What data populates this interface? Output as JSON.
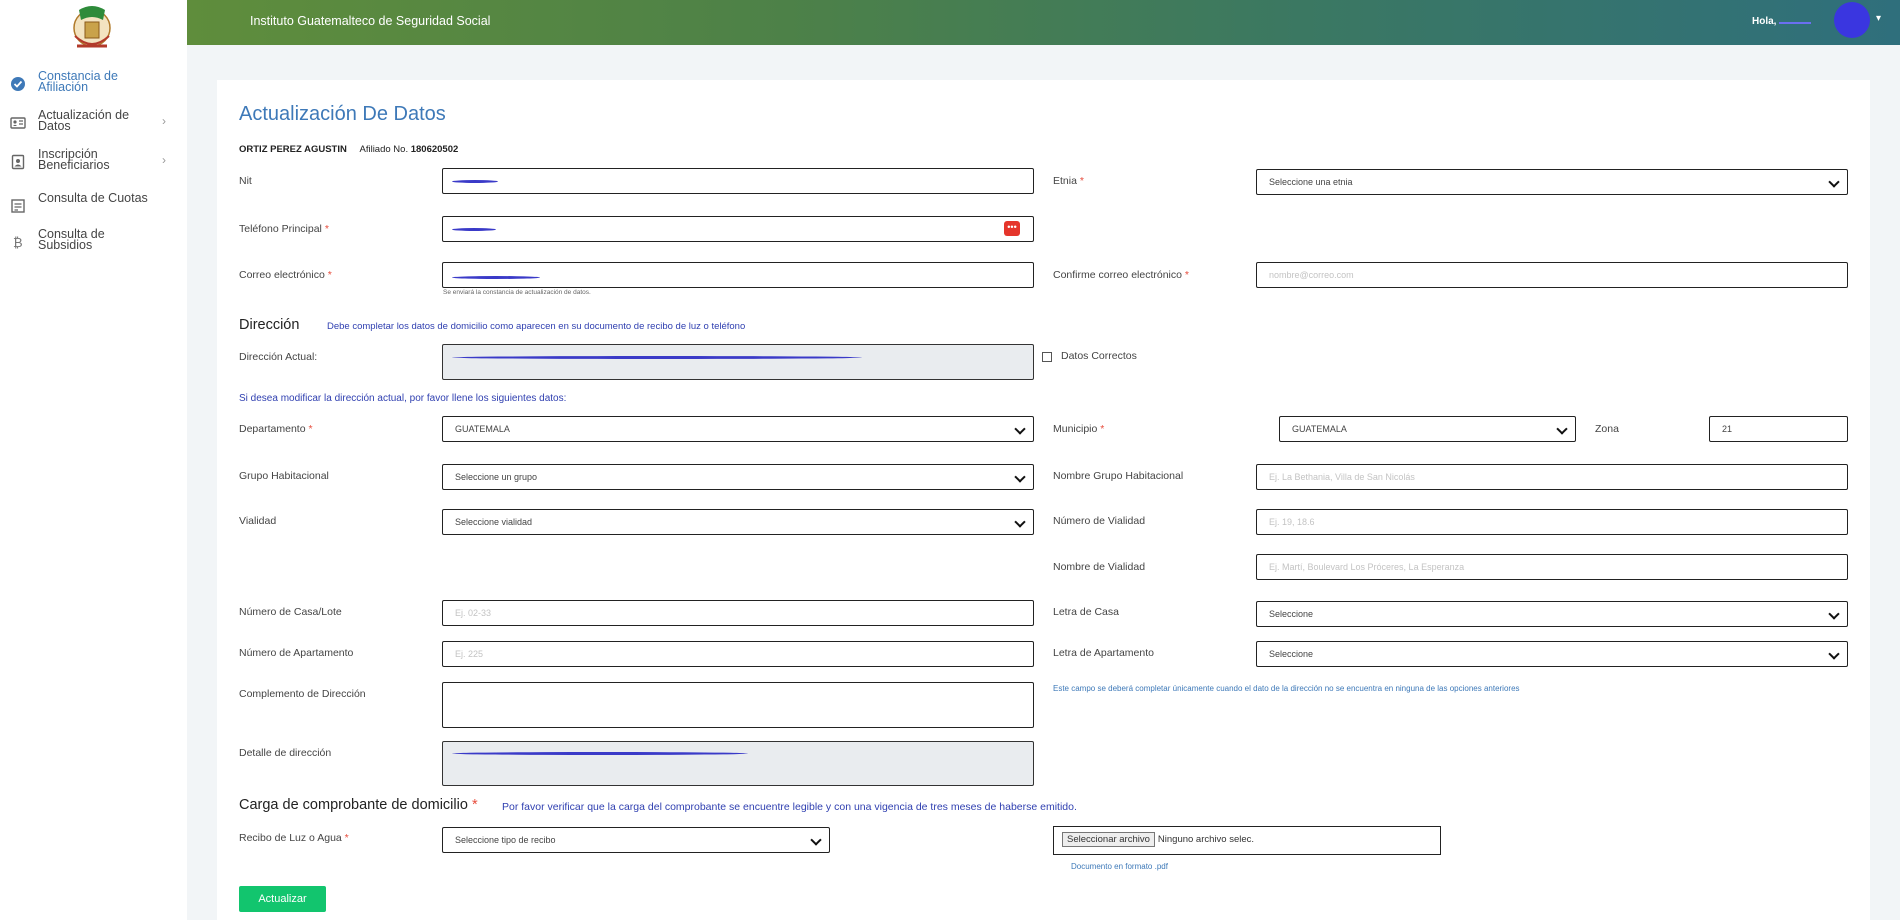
{
  "topbar": {
    "title": "Instituto Guatemalteco de Seguridad Social",
    "hello": "Hola, "
  },
  "sidebar": {
    "items": [
      {
        "label": "Constancia de Afiliación",
        "icon": "check-circle-icon",
        "active": true
      },
      {
        "label": "Actualización de Datos",
        "icon": "id-card-icon"
      },
      {
        "label": "Inscripción Beneficiarios",
        "icon": "user-badge-icon"
      },
      {
        "label": "Consulta de Cuotas",
        "icon": "receipt-icon"
      },
      {
        "label": "Consulta de Subsidios",
        "icon": "bitcoin-icon"
      }
    ]
  },
  "form": {
    "title": "Actualización De Datos",
    "name": "ORTIZ PEREZ AGUSTIN",
    "affiliate_label": "Afiliado No.",
    "affiliate_no": "180620502",
    "nit_label": "Nit",
    "etnia_label": "Etnia",
    "etnia_placeholder": "Seleccione una etnia",
    "phone_label": "Teléfono Principal",
    "email_label": "Correo electrónico",
    "email_hint": "Se enviará la constancia de actualización de datos.",
    "email_confirm_label": "Confirme correo electrónico",
    "email_confirm_placeholder": "nombre@correo.com",
    "address_heading": "Dirección",
    "address_note": "Debe completar los datos de domicilio como aparecen en su documento de recibo de luz o teléfono",
    "current_address_label": "Dirección Actual:",
    "correct_label": "Datos Correctos",
    "modify_note": "Si desea modificar la dirección actual, por favor llene los siguientes datos:",
    "dept_label": "Departamento",
    "dept_value": "GUATEMALA",
    "muni_label": "Municipio",
    "muni_value": "GUATEMALA",
    "zona_label": "Zona",
    "zona_value": "21",
    "group_label": "Grupo Habitacional",
    "group_placeholder": "Seleccione un grupo",
    "group_name_label": "Nombre Grupo Habitacional",
    "group_name_placeholder": "Ej. La Bethania, Villa de San Nicolás",
    "vialidad_label": "Vialidad",
    "vialidad_placeholder": "Seleccione vialidad",
    "vialidad_num_label": "Número de Vialidad",
    "vialidad_num_placeholder": "Ej. 19, 18.6",
    "vialidad_name_label": "Nombre de Vialidad",
    "vialidad_name_placeholder": "Ej. Martí, Boulevard Los Próceres, La Esperanza",
    "house_label": "Número de Casa/Lote",
    "house_placeholder": "Ej. 02-33",
    "house_letter_label": "Letra de Casa",
    "house_letter_value": "Seleccione",
    "apt_label": "Número de Apartamento",
    "apt_placeholder": "Ej. 225",
    "apt_letter_label": "Letra de Apartamento",
    "apt_letter_value": "Seleccione",
    "complement_label": "Complemento de Dirección",
    "complement_note": "Este campo se deberá completar únicamente cuando el dato de la dirección no se encuentra en ninguna de las opciones anteriores",
    "detail_label": "Detalle de dirección",
    "upload_heading": "Carga de comprobante de domicilio",
    "upload_note": "Por favor verificar que la carga del comprobante se encuentre legible y con una vigencia de tres meses de haberse emitido.",
    "receipt_label": "Recibo de Luz o Agua",
    "receipt_placeholder": "Seleccione tipo de recibo",
    "file_button": "Seleccionar archivo",
    "file_status": "Ninguno archivo selec.",
    "file_hint": "Documento en formato .pdf",
    "submit": "Actualizar",
    "req_mark": "*"
  },
  "colors": {
    "accent": "#3e79b8",
    "submit": "#12c56e",
    "required": "#e74c3c",
    "note": "#2f3fb0"
  }
}
